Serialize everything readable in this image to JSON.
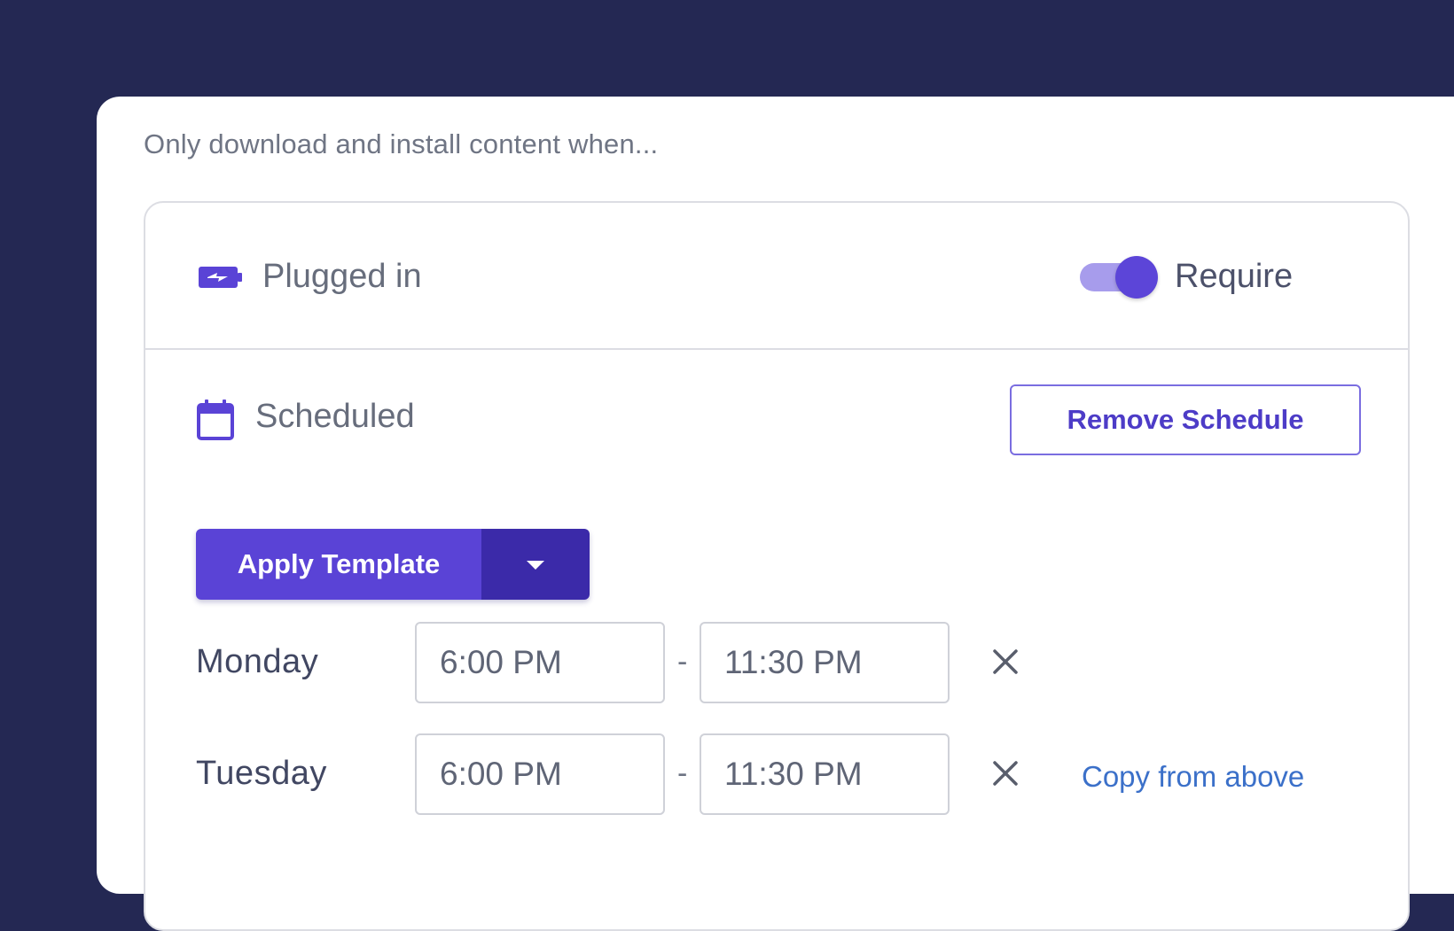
{
  "intro": {
    "text": "Only download and install content when..."
  },
  "plugged": {
    "label": "Plugged in",
    "icon": "battery-charging-icon",
    "toggle_on": true,
    "toggle_label": "Require"
  },
  "scheduled": {
    "label": "Scheduled",
    "icon": "calendar-icon",
    "remove_button": "Remove Schedule",
    "apply_template": "Apply Template",
    "dropdown_icon": "caret-down-icon"
  },
  "days": [
    {
      "name": "Monday",
      "start": "6:00 PM",
      "end": "11:30 PM",
      "separator": "-",
      "copy_link": ""
    },
    {
      "name": "Tuesday",
      "start": "6:00 PM",
      "end": "11:30 PM",
      "separator": "-",
      "copy_link": "Copy from above"
    }
  ],
  "colors": {
    "background": "#242853",
    "accent": "#5a43d6",
    "accent_dark": "#3b2aa9",
    "link": "#3b70c9"
  }
}
